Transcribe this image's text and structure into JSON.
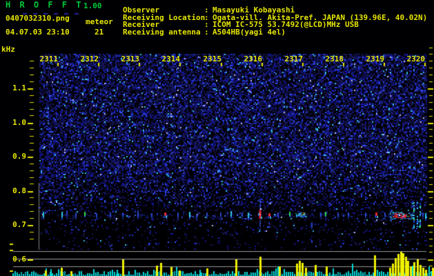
{
  "app": {
    "title": "H R O F F T",
    "version": "1.00",
    "filename": "0407032310.png",
    "datetime": "04.07.03 23:10",
    "mode_label": "meteor",
    "meteor_count": "21"
  },
  "station": {
    "colon": ":",
    "rows": [
      {
        "label": "Observer",
        "value": "Masayuki Kobayashi"
      },
      {
        "label": "Receiving Location",
        "value": "Ogata-vill. Akita-Pref. JAPAN (139.96E, 40.02N)"
      },
      {
        "label": "Receiver",
        "value": "ICOM IC-575 53.7492(@LCD)MHz USB"
      },
      {
        "label": "Receiving antenna",
        "value": "A504HB(yagi 4el)"
      }
    ]
  },
  "colors": {
    "text_yellow": "#e6e600",
    "title_green": "#00c838",
    "grid_gray": "#9a9a9a",
    "border_gray": "#808080",
    "noise_bar_cyan": "#00d8d8",
    "echo_spike_yellow": "#f0f000",
    "tick_yellow": "#e6e600"
  },
  "chart_data": [
    {
      "type": "heatmap",
      "name": "doppler-spectrogram",
      "title": "HROFFT meteor radio echo spectrogram 23:10-23:20",
      "ylabel": "kHz",
      "y_ticks": [
        "1.1",
        "1.0",
        "0.9",
        "0.8",
        "0.7",
        "0.6"
      ],
      "y_range_khz": [
        0.6,
        1.2
      ],
      "x_ticks": [
        "2311",
        "2312",
        "2313",
        "2314",
        "2315",
        "2316",
        "2317",
        "2318",
        "2319",
        "2320"
      ],
      "x_range_minutes_after_2310": [
        0,
        10
      ],
      "echo_band_khz": 0.73,
      "grid": false,
      "events_format": [
        "t_minutes_after_2310",
        "freq_khz",
        "kind"
      ],
      "events": [
        [
          0.11,
          0.73,
          "cyan"
        ],
        [
          0.59,
          0.73,
          "cyan"
        ],
        [
          0.71,
          0.735,
          "blue"
        ],
        [
          0.94,
          0.73,
          "blue"
        ],
        [
          1.18,
          0.732,
          "green"
        ],
        [
          1.48,
          0.728,
          "blue"
        ],
        [
          1.84,
          0.73,
          "blue"
        ],
        [
          2.0,
          0.717,
          "white"
        ],
        [
          2.16,
          0.73,
          "blue"
        ],
        [
          2.55,
          0.73,
          "blue"
        ],
        [
          2.91,
          0.728,
          "blue"
        ],
        [
          3.24,
          0.732,
          "red"
        ],
        [
          3.58,
          0.73,
          "blue"
        ],
        [
          3.89,
          0.73,
          "cyan"
        ],
        [
          4.06,
          0.726,
          "blue"
        ],
        [
          4.33,
          0.73,
          "blue"
        ],
        [
          4.69,
          0.73,
          "blue"
        ],
        [
          4.96,
          0.732,
          "cyan"
        ],
        [
          5.24,
          0.73,
          "blue"
        ],
        [
          5.4,
          0.728,
          "cyan"
        ],
        [
          5.7,
          0.73,
          "strong"
        ],
        [
          5.94,
          0.73,
          "red"
        ],
        [
          6.17,
          0.73,
          "blue"
        ],
        [
          6.47,
          0.731,
          "green"
        ],
        [
          6.76,
          0.729,
          "smear"
        ],
        [
          7.04,
          0.698,
          "blue"
        ],
        [
          7.27,
          0.73,
          "blue"
        ],
        [
          7.4,
          0.731,
          "green"
        ],
        [
          7.72,
          0.73,
          "blue"
        ],
        [
          7.99,
          0.73,
          "blue"
        ],
        [
          8.43,
          0.73,
          "blue"
        ],
        [
          8.7,
          0.732,
          "red"
        ],
        [
          8.93,
          0.73,
          "blue"
        ],
        [
          9.32,
          0.728,
          "big"
        ],
        [
          9.68,
          0.73,
          "vstreak"
        ],
        [
          9.77,
          0.73,
          "vstreak"
        ],
        [
          9.84,
          0.728,
          "vstreak"
        ],
        [
          9.91,
          0.73,
          "blue"
        ],
        [
          9.98,
          0.725,
          "cyan"
        ]
      ]
    },
    {
      "type": "bar",
      "name": "signal-level-strip",
      "title": "received signal level vs time",
      "series": [
        {
          "name": "noise-floor",
          "color": "#00d8d8",
          "peaks_format": [
            "t_minutes_after_2310",
            "height_px"
          ],
          "peaks": [
            [
              0.3,
              10
            ],
            [
              2.02,
              9
            ],
            [
              4.15,
              9
            ],
            [
              6.33,
              10
            ],
            [
              7.6,
              11
            ],
            [
              8.2,
              9
            ],
            [
              10.07,
              14
            ]
          ]
        },
        {
          "name": "meteor-echoes",
          "color": "#f0f000",
          "points_format": [
            "t_minutes_after_2310",
            "height_px"
          ],
          "points": [
            [
              0.16,
              8
            ],
            [
              0.57,
              12
            ],
            [
              0.82,
              7
            ],
            [
              2.16,
              24
            ],
            [
              3.03,
              15
            ],
            [
              3.14,
              19
            ],
            [
              3.4,
              13
            ],
            [
              3.62,
              8
            ],
            [
              4.33,
              11
            ],
            [
              5.08,
              24
            ],
            [
              5.7,
              28
            ],
            [
              6.2,
              14
            ],
            [
              6.65,
              18
            ],
            [
              6.72,
              22
            ],
            [
              6.79,
              19
            ],
            [
              6.88,
              12
            ],
            [
              7.13,
              16
            ],
            [
              7.42,
              14
            ],
            [
              8.66,
              30
            ],
            [
              9.06,
              12
            ],
            [
              9.13,
              18
            ],
            [
              9.2,
              26
            ],
            [
              9.27,
              32
            ],
            [
              9.34,
              35
            ],
            [
              9.39,
              33
            ],
            [
              9.46,
              28
            ],
            [
              9.52,
              22
            ],
            [
              9.59,
              14
            ],
            [
              9.68,
              20
            ],
            [
              9.77,
              24
            ],
            [
              9.84,
              16
            ],
            [
              9.91,
              12
            ],
            [
              9.98,
              9
            ],
            [
              10.16,
              12
            ]
          ]
        }
      ]
    }
  ]
}
